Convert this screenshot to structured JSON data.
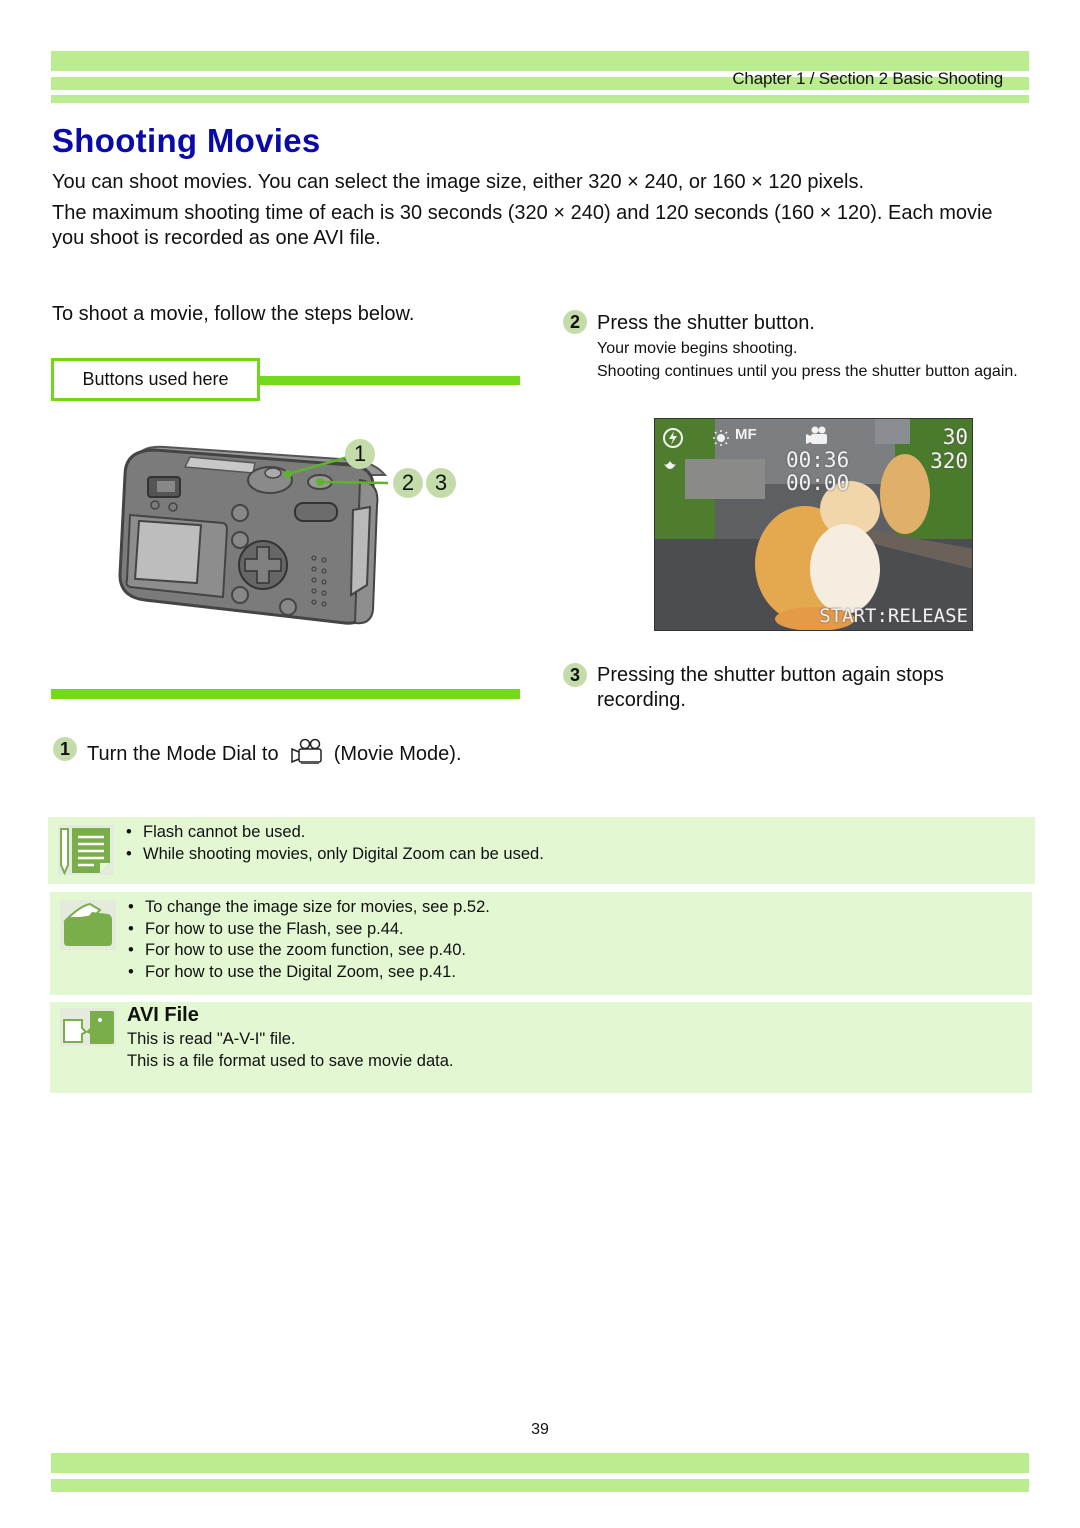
{
  "header": {
    "chapter_label": "Chapter 1 / Section 2  Basic Shooting"
  },
  "title": "Shooting Movies",
  "intro": {
    "para1": "You can shoot movies. You can select the image size, either 320 × 240, or 160 × 120 pixels.",
    "para2": "The maximum shooting time of each is 30 seconds (320 × 240) and 120 seconds (160 × 120). Each movie you shoot is recorded as one AVI file."
  },
  "steps_intro": "To shoot a movie, follow the steps below.",
  "buttons_used_label": "Buttons used here",
  "camera_callouts": [
    "1",
    "2",
    "3"
  ],
  "steps": [
    {
      "number": "1",
      "text_before_icon": "Turn the Mode Dial to",
      "icon": "movie-mode-icon",
      "text_after_icon": "(Movie Mode)."
    },
    {
      "number": "2",
      "heading": "Press the shutter button.",
      "sub1": "Your movie begins shooting.",
      "sub2": "Shooting continues until you press the shutter button again."
    },
    {
      "number": "3",
      "heading": "Pressing the shutter button again stops recording."
    }
  ],
  "lcd": {
    "elapsed": "00:36",
    "remaining": "00:00",
    "frame_rate": "30",
    "size": "320",
    "focus": "MF",
    "prompt": "START:RELEASE",
    "icons": [
      "flash-off-icon",
      "white-balance-icon",
      "macro-icon",
      "movie-mode-icon"
    ]
  },
  "notes": {
    "caution": {
      "icon": "memo-pencil-icon",
      "items": [
        "Flash cannot be used.",
        "While shooting movies, only Digital Zoom can be used."
      ]
    },
    "reference": {
      "icon": "folder-icon",
      "items": [
        "To change the image size for movies, see p.52.",
        "For how to use the Flash, see p.44.",
        "For how to use the zoom function, see p.40.",
        "For how to use the Digital Zoom, see p.41."
      ]
    },
    "term": {
      "icon": "speech-bubble-icon",
      "title": "AVI File",
      "line1": "This is read \"A-V-I\" file.",
      "line2": "This is a file format used to save movie data."
    }
  },
  "page_number": "39",
  "colors": {
    "title_blue": "#0a0aa8",
    "header_bar_green": "#bbec8f",
    "accent_green": "#72d91d",
    "badge_green": "#c3dcaa",
    "note_bg": "#e2f7d2",
    "icon_green": "#7aae4b"
  }
}
